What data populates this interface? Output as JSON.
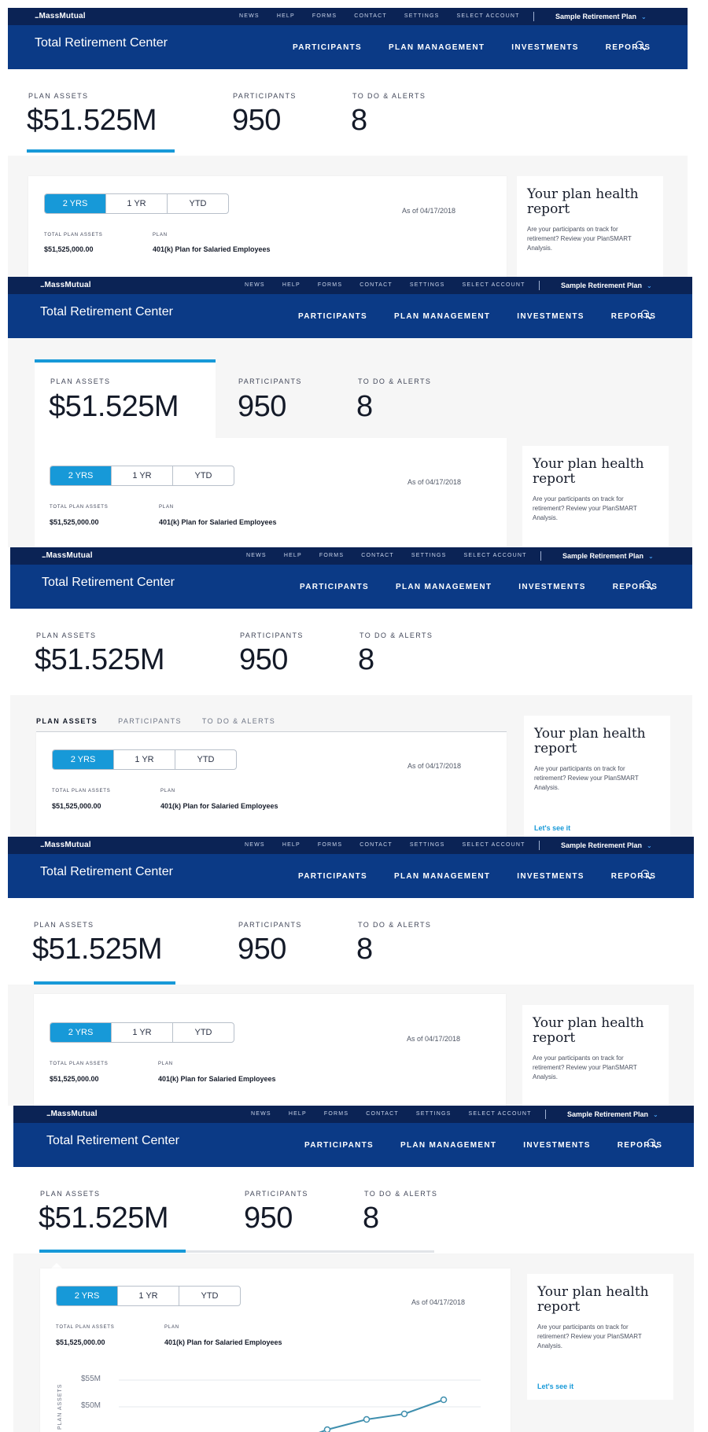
{
  "brand": {
    "logo": "MassMutual",
    "logo_dots": "...",
    "app_title": "Total Retirement Center"
  },
  "utility_nav": [
    "NEWS",
    "HELP",
    "FORMS",
    "CONTACT",
    "SETTINGS",
    "SELECT ACCOUNT"
  ],
  "plan_selector": {
    "label": "Sample Retirement Plan",
    "icon": "chevron-down-icon"
  },
  "main_nav": [
    "PARTICIPANTS",
    "PLAN MANAGEMENT",
    "INVESTMENTS",
    "REPORTS"
  ],
  "stats": [
    {
      "label": "PLAN ASSETS",
      "value": "$51.525M"
    },
    {
      "label": "PARTICIPANTS",
      "value": "950"
    },
    {
      "label": "TO DO & ALERTS",
      "value": "8"
    }
  ],
  "subtabs": [
    "PLAN ASSETS",
    "PARTICIPANTS",
    "TO DO & ALERTS"
  ],
  "range_buttons": [
    "2 YRS",
    "1 YR",
    "YTD"
  ],
  "as_of": "As of 04/17/2018",
  "summary": {
    "total_label": "TOTAL PLAN ASSETS",
    "total_value": "$51,525,000.00",
    "plan_label": "PLAN",
    "plan_value": "401(k) Plan for Salaried Employees"
  },
  "health": {
    "title": "Your plan health report",
    "body": "Are your participants on track for retirement? Review your PlanSMART Analysis.",
    "link": "Let's see it"
  },
  "chart_axis": {
    "ylabel": "PLAN ASSETS",
    "ticks": [
      "$55M",
      "$50M"
    ]
  },
  "colors": {
    "topbar": "#0b2355",
    "navbar": "#0b3a86",
    "accent": "#1799d8"
  }
}
